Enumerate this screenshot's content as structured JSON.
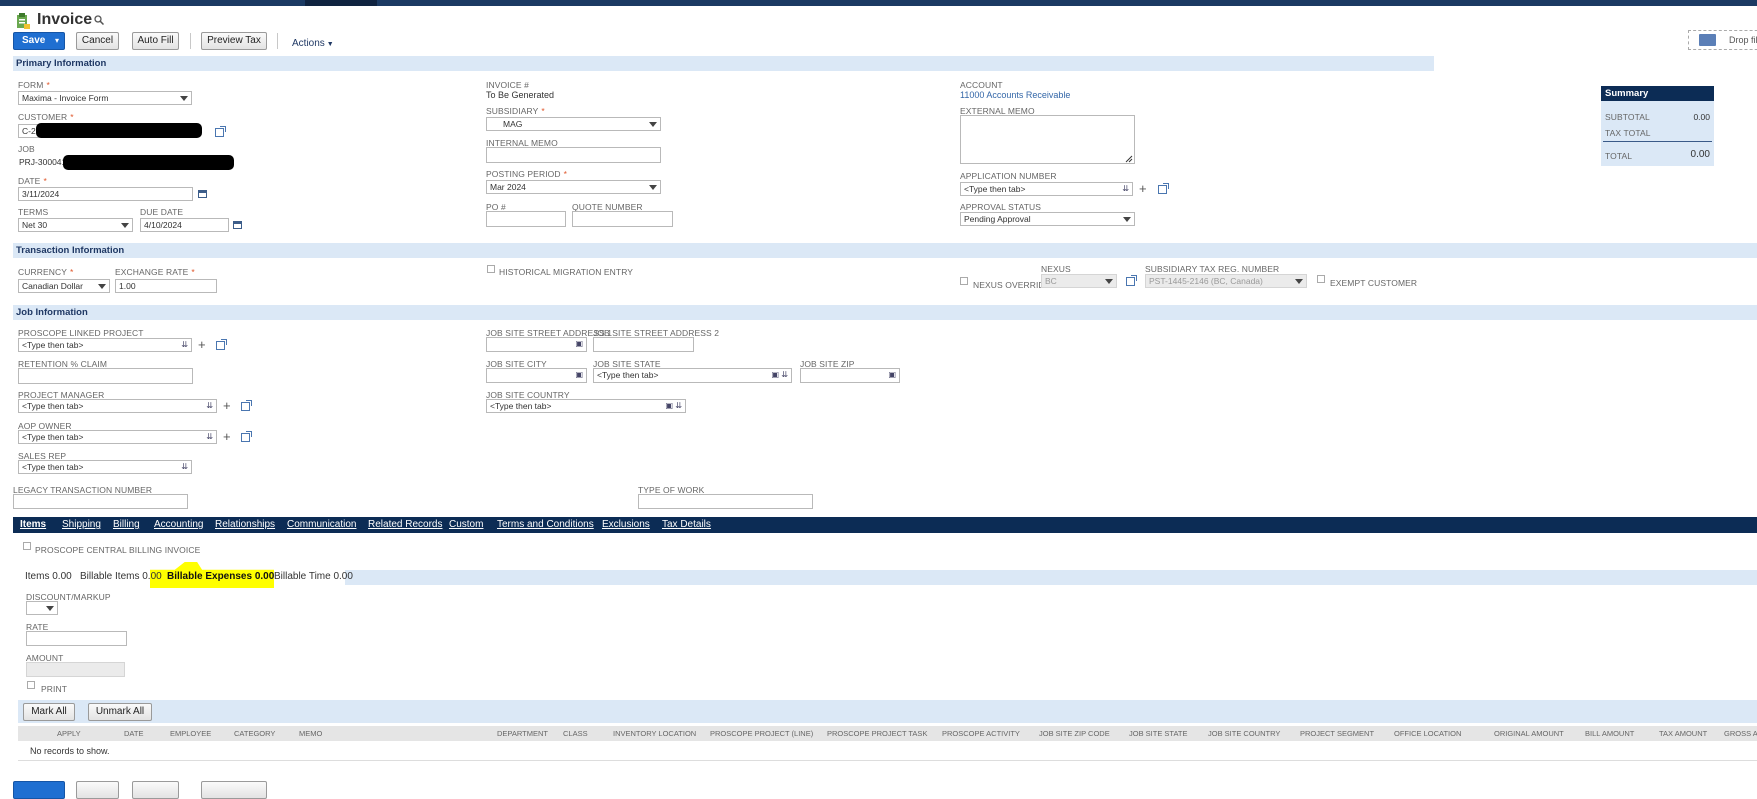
{
  "page": {
    "title": "Invoice",
    "drop_label": "Drop fil"
  },
  "toolbar": {
    "save": "Save",
    "cancel": "Cancel",
    "auto_fill": "Auto Fill",
    "preview_tax": "Preview Tax",
    "actions": "Actions"
  },
  "sections": {
    "primary": "Primary Information",
    "transaction": "Transaction Information",
    "job": "Job Information"
  },
  "primary": {
    "form_label": "FORM",
    "form_value": "Maxima - Invoice Form",
    "customer_label": "CUSTOMER",
    "customer_value": "C-2",
    "job_label": "JOB",
    "job_value": "PRJ-300041",
    "date_label": "DATE",
    "date_value": "3/11/2024",
    "terms_label": "TERMS",
    "terms_value": "Net 30",
    "due_label": "DUE DATE",
    "due_value": "4/10/2024",
    "invoice_no_label": "INVOICE #",
    "invoice_no_value": "To Be Generated",
    "subsidiary_label": "SUBSIDIARY",
    "subsidiary_value": "MAG",
    "internal_memo_label": "INTERNAL MEMO",
    "posting_label": "POSTING PERIOD",
    "posting_value": "Mar 2024",
    "po_label": "PO #",
    "quote_label": "QUOTE NUMBER",
    "account_label": "ACCOUNT",
    "account_value": "11000 Accounts Receivable",
    "external_memo_label": "EXTERNAL MEMO",
    "app_number_label": "APPLICATION NUMBER",
    "app_number_value": "<Type then tab>",
    "approval_label": "APPROVAL STATUS",
    "approval_value": "Pending Approval"
  },
  "summary": {
    "title": "Summary",
    "subtotal_label": "SUBTOTAL",
    "subtotal_value": "0.00",
    "tax_label": "TAX TOTAL",
    "total_label": "TOTAL",
    "total_value": "0.00"
  },
  "transaction": {
    "currency_label": "CURRENCY",
    "currency_value": "Canadian Dollar",
    "rate_label": "EXCHANGE RATE",
    "rate_value": "1.00",
    "historical_label": "HISTORICAL MIGRATION ENTRY",
    "nexus_override_label": "NEXUS OVERRIDE",
    "nexus_label": "NEXUS",
    "nexus_value": "BC",
    "taxreg_label": "SUBSIDIARY TAX REG. NUMBER",
    "taxreg_value": "PST-1445-2146 (BC, Canada)",
    "exempt_label": "EXEMPT CUSTOMER"
  },
  "job": {
    "proscope_label": "PROSCOPE LINKED PROJECT",
    "proscope_value": "<Type then tab>",
    "retention_label": "RETENTION % CLAIM",
    "pm_label": "PROJECT MANAGER",
    "pm_value": "<Type then tab>",
    "aop_label": "AOP OWNER",
    "aop_value": "<Type then tab>",
    "sales_label": "SALES REP",
    "sales_value": "<Type then tab>",
    "legacy_label": "LEGACY TRANSACTION NUMBER",
    "street1_label": "JOB SITE STREET ADDRESS 1",
    "street2_label": "JOB SITE STREET ADDRESS 2",
    "city_label": "JOB SITE CITY",
    "state_label": "JOB SITE STATE",
    "state_value": "<Type then tab>",
    "zip_label": "JOB SITE ZIP",
    "country_label": "JOB SITE COUNTRY",
    "country_value": "<Type then tab>",
    "type_label": "TYPE OF WORK"
  },
  "tabs": [
    "Items",
    "Shipping",
    "Billing",
    "Accounting",
    "Relationships",
    "Communication",
    "Related Records",
    "Custom",
    "Terms and Conditions",
    "Exclusions",
    "Tax Details"
  ],
  "items": {
    "central_billing_label": "PROSCOPE CENTRAL BILLING INVOICE",
    "subtabs": [
      "Items 0.00",
      "Billable Items 0.00",
      "Billable Expenses 0.00",
      "Billable Time 0.00"
    ],
    "discount_label": "DISCOUNT/MARKUP",
    "rate_label": "RATE",
    "amount_label": "AMOUNT",
    "print_label": "PRINT",
    "mark_all": "Mark All",
    "unmark_all": "Unmark All",
    "columns": [
      "APPLY",
      "DATE",
      "EMPLOYEE",
      "CATEGORY",
      "MEMO",
      "DEPARTMENT",
      "CLASS",
      "INVENTORY LOCATION",
      "PROSCOPE PROJECT (LINE)",
      "PROSCOPE PROJECT TASK",
      "PROSCOPE ACTIVITY",
      "JOB SITE ZIP CODE",
      "JOB SITE STATE",
      "JOB SITE COUNTRY",
      "PROJECT SEGMENT",
      "OFFICE LOCATION",
      "ORIGINAL AMOUNT",
      "BILL AMOUNT",
      "TAX AMOUNT",
      "GROSS AM"
    ],
    "empty": "No records to show."
  },
  "colors": {
    "nav": "#0c2c55",
    "section": "#dbe8f6",
    "primary_button": "#1f6fd1",
    "highlight": "#ffff00",
    "required": "#e0572b"
  }
}
